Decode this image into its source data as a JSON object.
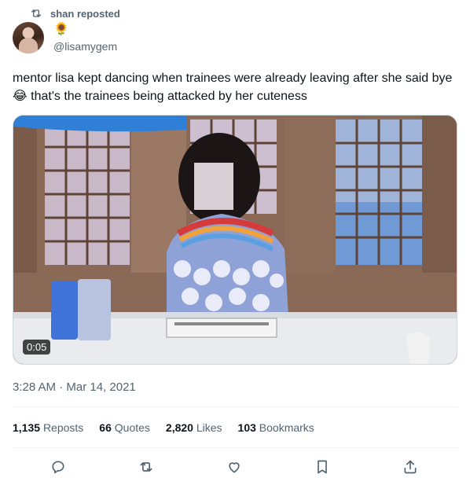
{
  "repost": {
    "text": "shan reposted",
    "icon": "repost-icon"
  },
  "author": {
    "name_emoji": "🌻",
    "handle": "@lisamygem"
  },
  "tweet": {
    "text_part1": "mentor lisa kept dancing when trainees were already leaving after she said bye ",
    "emoji": "😂",
    "text_part2": " that's the trainees being attacked by her cuteness"
  },
  "media": {
    "duration": "0:05"
  },
  "date_time": "3:28 AM · Mar 14, 2021",
  "stats": [
    {
      "num": "1,135",
      "label": "Reposts"
    },
    {
      "num": "66",
      "label": "Quotes"
    },
    {
      "num": "2,820",
      "label": "Likes"
    },
    {
      "num": "103",
      "label": "Bookmarks"
    }
  ],
  "actions": [
    "reply-icon",
    "repost-icon",
    "like-icon",
    "bookmark-icon",
    "share-icon"
  ],
  "colors": {
    "secondary_text": "#536471",
    "primary_text": "#0f1419",
    "border": "#cfd9de"
  }
}
